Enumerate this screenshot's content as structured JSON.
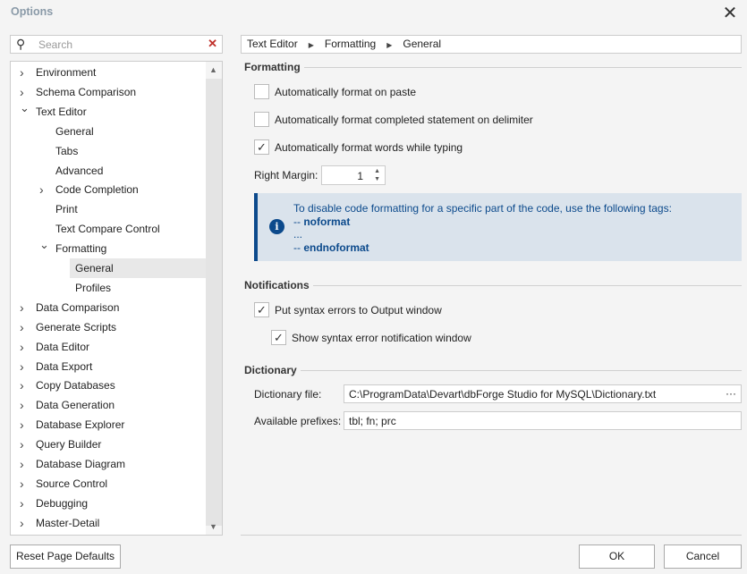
{
  "title": "Options",
  "search": {
    "placeholder": "Search"
  },
  "tree": [
    {
      "label": "Environment",
      "level": 0,
      "arrow": "collapsed"
    },
    {
      "label": "Schema Comparison",
      "level": 0,
      "arrow": "collapsed"
    },
    {
      "label": "Text Editor",
      "level": 0,
      "arrow": "expanded"
    },
    {
      "label": "General",
      "level": 1,
      "arrow": "none"
    },
    {
      "label": "Tabs",
      "level": 1,
      "arrow": "none"
    },
    {
      "label": "Advanced",
      "level": 1,
      "arrow": "none"
    },
    {
      "label": "Code Completion",
      "level": 1,
      "arrow": "collapsed"
    },
    {
      "label": "Print",
      "level": 1,
      "arrow": "none"
    },
    {
      "label": "Text Compare Control",
      "level": 1,
      "arrow": "none"
    },
    {
      "label": "Formatting",
      "level": 1,
      "arrow": "expanded"
    },
    {
      "label": "General",
      "level": 2,
      "arrow": "none",
      "selected": true
    },
    {
      "label": "Profiles",
      "level": 2,
      "arrow": "none"
    },
    {
      "label": "Data Comparison",
      "level": 0,
      "arrow": "collapsed"
    },
    {
      "label": "Generate Scripts",
      "level": 0,
      "arrow": "collapsed"
    },
    {
      "label": "Data Editor",
      "level": 0,
      "arrow": "collapsed"
    },
    {
      "label": "Data Export",
      "level": 0,
      "arrow": "collapsed"
    },
    {
      "label": "Copy Databases",
      "level": 0,
      "arrow": "collapsed"
    },
    {
      "label": "Data Generation",
      "level": 0,
      "arrow": "collapsed"
    },
    {
      "label": "Database Explorer",
      "level": 0,
      "arrow": "collapsed"
    },
    {
      "label": "Query Builder",
      "level": 0,
      "arrow": "collapsed"
    },
    {
      "label": "Database Diagram",
      "level": 0,
      "arrow": "collapsed"
    },
    {
      "label": "Source Control",
      "level": 0,
      "arrow": "collapsed"
    },
    {
      "label": "Debugging",
      "level": 0,
      "arrow": "collapsed"
    },
    {
      "label": "Master-Detail",
      "level": 0,
      "arrow": "collapsed"
    }
  ],
  "breadcrumb": [
    "Text Editor",
    "Formatting",
    "General"
  ],
  "formatting": {
    "heading": "Formatting",
    "opt1": {
      "label": "Automatically format on paste",
      "checked": false
    },
    "opt2": {
      "label": "Automatically format completed statement on delimiter",
      "checked": false
    },
    "opt3": {
      "label": "Automatically format words while typing",
      "checked": true
    },
    "right_margin_label": "Right Margin:",
    "right_margin_value": "1",
    "info_line1": "To disable code formatting for a specific part of the code, use the following tags:",
    "info_line2_prefix": "-- ",
    "info_line2_tag": "noformat",
    "info_line3": "...",
    "info_line4_prefix": "-- ",
    "info_line4_tag": "endnoformat"
  },
  "notifications": {
    "heading": "Notifications",
    "opt1": {
      "label": "Put syntax errors to Output window",
      "checked": true
    },
    "opt2": {
      "label": "Show syntax error notification window",
      "checked": true
    }
  },
  "dictionary": {
    "heading": "Dictionary",
    "file_label": "Dictionary file:",
    "file_value": "C:\\ProgramData\\Devart\\dbForge Studio for MySQL\\Dictionary.txt",
    "browse": "···",
    "prefixes_label": "Available prefixes:",
    "prefixes_value": "tbl; fn; prc"
  },
  "buttons": {
    "reset": "Reset Page Defaults",
    "ok": "OK",
    "cancel": "Cancel"
  }
}
